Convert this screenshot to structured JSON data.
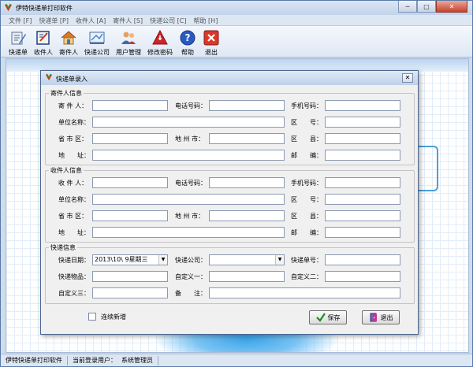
{
  "app": {
    "title": "伊特快递单打印软件",
    "window_buttons": [
      "─",
      "□",
      "✕"
    ]
  },
  "menu": [
    "文件 [F]",
    "快递单 [P]",
    "收件人 [A]",
    "寄件人 [S]",
    "快递公司 [C]",
    "帮助 [H]"
  ],
  "toolbar": [
    {
      "label": "快递单",
      "icon": "waybill-icon"
    },
    {
      "label": "收件人",
      "icon": "receiver-icon"
    },
    {
      "label": "寄件人",
      "icon": "sender-house-icon"
    },
    {
      "label": "快递公司",
      "icon": "express-company-icon"
    },
    {
      "label": "用户管理",
      "icon": "user-management-icon"
    },
    {
      "label": "修改密码",
      "icon": "change-password-icon"
    },
    {
      "label": "帮助",
      "icon": "help-icon"
    },
    {
      "label": "退出",
      "icon": "exit-icon"
    }
  ],
  "status": {
    "app_name": "伊特快递单打印软件",
    "current_user_label": "当前登录用户：",
    "current_user": "系统管理员"
  },
  "dialog": {
    "title": "快递单录入",
    "close": "✕",
    "sender": {
      "group_label": "寄件人信息",
      "name": "寄 件 人：",
      "phone": "电话号码：",
      "mobile": "手机号码：",
      "company": "单位名称：",
      "district": "区　　号：",
      "province": "省 市 区：",
      "city": "地 州 市：",
      "county": "区　　县：",
      "address": "地　　址：",
      "postcode": "邮　　编："
    },
    "receiver": {
      "group_label": "收件人信息",
      "name": "收 件 人：",
      "phone": "电话号码：",
      "mobile": "手机号码：",
      "company": "单位名称：",
      "district": "区　　号：",
      "province": "省 市 区：",
      "city": "地 州 市：",
      "county": "区　　县：",
      "address": "地　　址：",
      "postcode": "邮　　编："
    },
    "express": {
      "group_label": "快递信息",
      "date_label": "快递日期：",
      "date_value": "2013\\10\\ 9星期三",
      "company_label": "快递公司：",
      "company_value": "",
      "number_label": "快递单号：",
      "goods_label": "快递物品：",
      "custom1_label": "自定义一：",
      "custom2_label": "自定义二：",
      "custom3_label": "自定义三：",
      "remark_label": "备　　注："
    },
    "continuous_add": "连续新增",
    "save": "保存",
    "exit": "退出"
  }
}
